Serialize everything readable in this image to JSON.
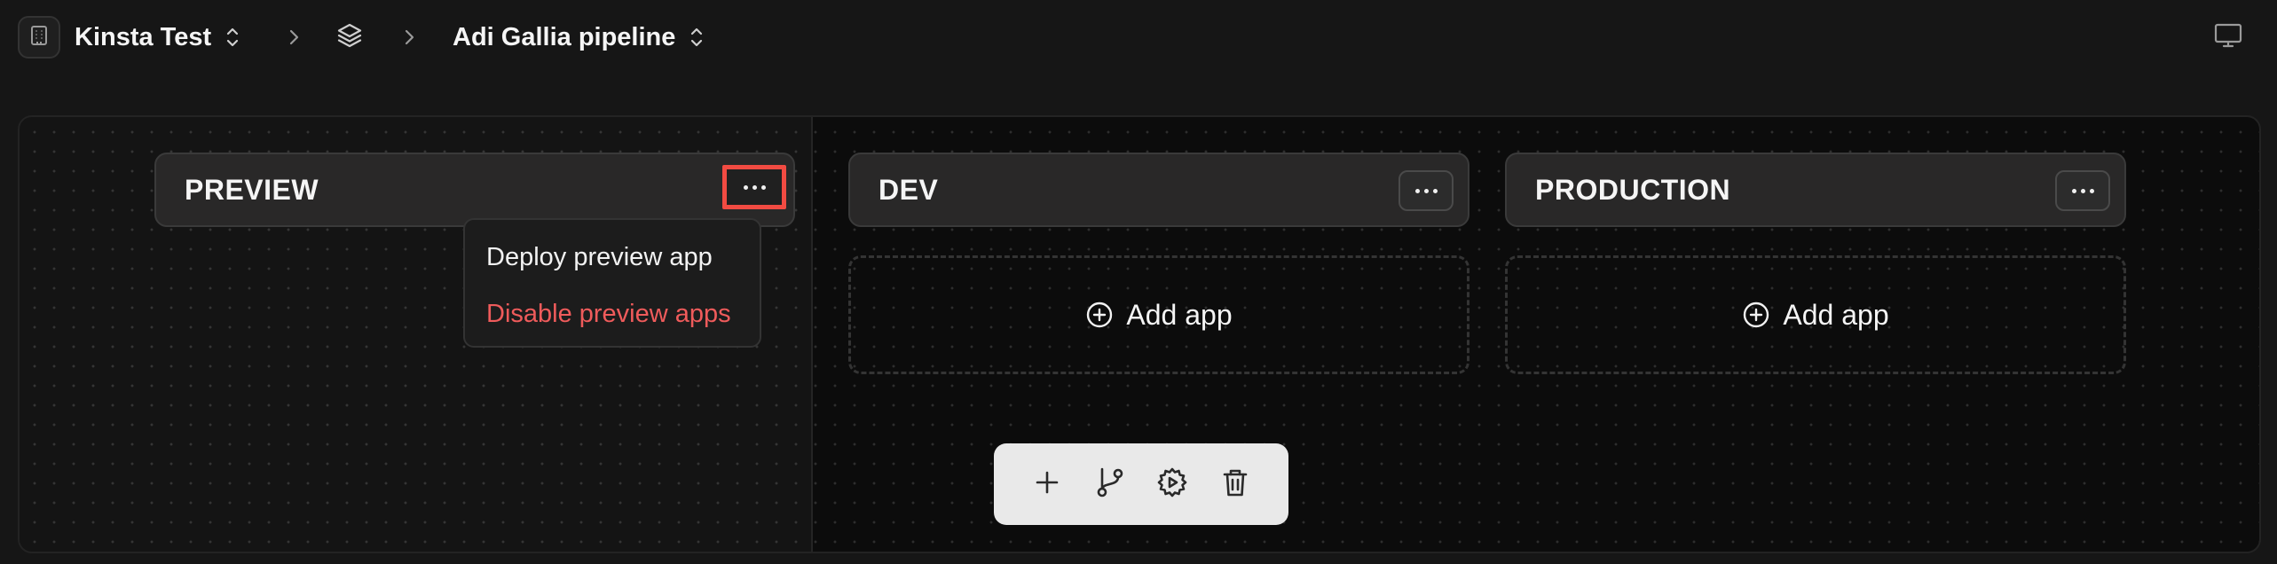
{
  "header": {
    "company_name": "Kinsta Test",
    "pipeline_name": "Adi Gallia pipeline",
    "icons": {
      "company": "building-icon",
      "switch": "chevron-updown-icon",
      "separator": "chevron-right-icon",
      "pipelines": "layers-icon",
      "display": "monitor-icon"
    }
  },
  "stages": [
    {
      "name": "PREVIEW",
      "menu_open": true
    },
    {
      "name": "DEV",
      "add_app_label": "Add app"
    },
    {
      "name": "PRODUCTION",
      "add_app_label": "Add app"
    }
  ],
  "preview_menu": {
    "items": [
      {
        "label": "Deploy preview app",
        "variant": "default"
      },
      {
        "label": "Disable preview apps",
        "variant": "danger"
      }
    ]
  },
  "toolbar": {
    "icons": [
      "plus-icon",
      "git-branch-icon",
      "settings-gear-icon",
      "trash-icon"
    ]
  },
  "colors": {
    "highlight": "#f24b42",
    "danger_text": "#ef5b5b",
    "background": "#161616",
    "toolbar_bg": "#e9e9e9"
  }
}
